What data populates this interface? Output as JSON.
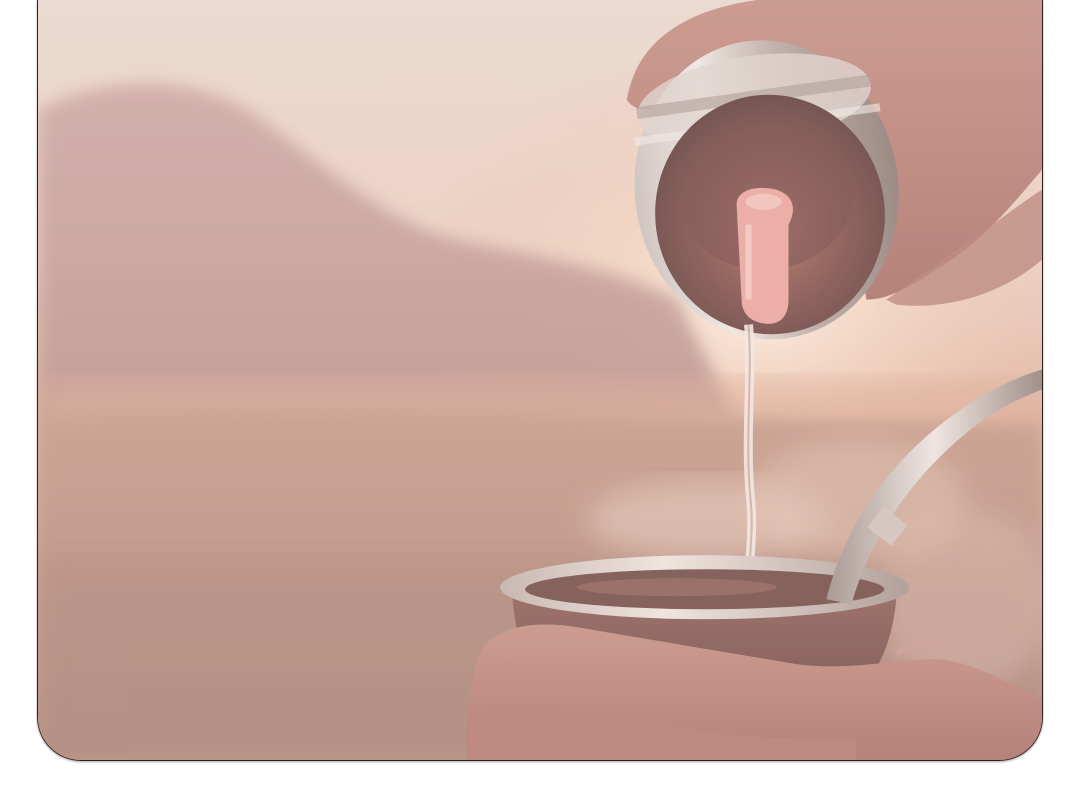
{
  "photo": {
    "alt": "",
    "overlay_color": "#f3d6cf"
  }
}
